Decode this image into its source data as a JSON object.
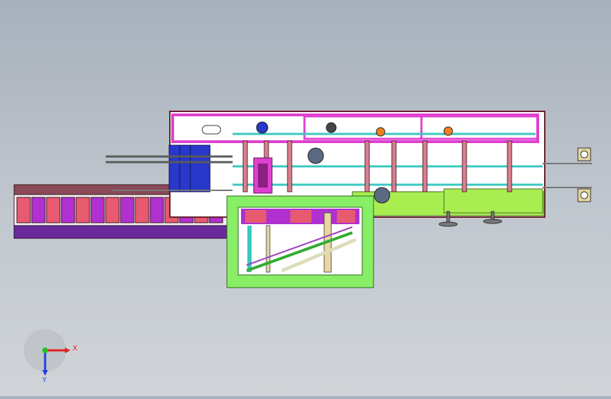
{
  "viewport": {
    "background_top": "#a7b0bc",
    "background_bottom": "#d0d4d8"
  },
  "palette": {
    "frame_outline": "#6b1f2a",
    "magenta_frame": "#e040d0",
    "pink_bin": "#e85a70",
    "purple_bin": "#b030d0",
    "conveyor_brown": "#8a4a58",
    "conveyor_purple": "#6a2a9a",
    "blue_block": "#2838c8",
    "green_frame": "#88ee66",
    "lime_base": "#a8ee50",
    "cyan_rail": "#3ac8c0",
    "tan_part": "#e8d8a0",
    "white_fill": "#f8f8f8",
    "gray_wheel": "#5a6a80"
  },
  "triad": {
    "x_label": "X",
    "y_label": "Y",
    "x_color": "#e02020",
    "y_color": "#2040e0",
    "origin_color": "#20c020"
  }
}
